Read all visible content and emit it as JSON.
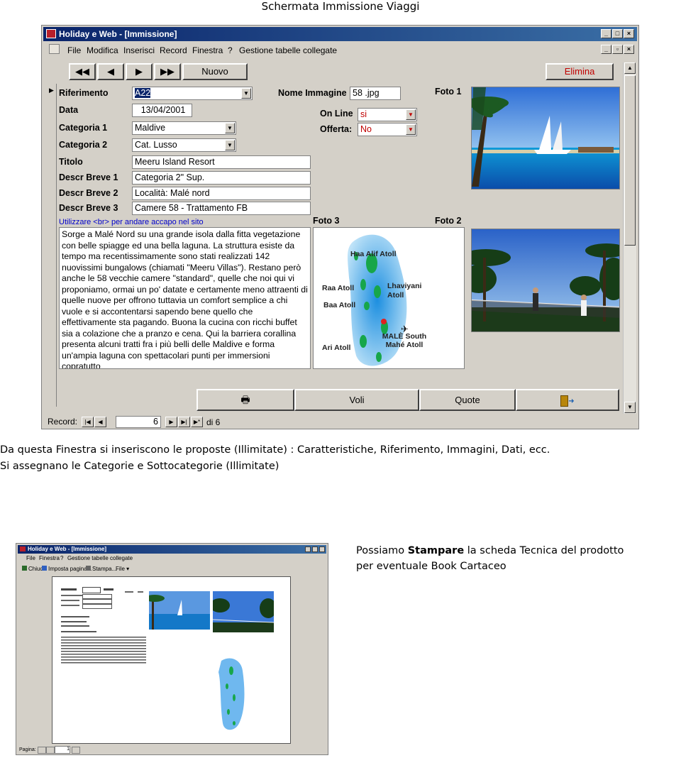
{
  "page_title": "Schermata Immissione Viaggi",
  "app": {
    "window_title": "Holiday e Web - [Immissione]",
    "menu": [
      "File",
      "Modifica",
      "Inserisci",
      "Record",
      "Finestra",
      "?",
      "Gestione tabelle collegate"
    ],
    "nav_buttons": {
      "first": "◀◀",
      "prev": "◀",
      "next": "▶",
      "last": "▶▶"
    },
    "nuovo": "Nuovo",
    "elimina": "Elimina",
    "labels": {
      "riferimento": "Riferimento",
      "data": "Data",
      "categoria1": "Categoria 1",
      "categoria2": "Categoria 2",
      "titolo": "Titolo",
      "descr1": "Descr Breve 1",
      "descr2": "Descr Breve 2",
      "descr3": "Descr Breve 3",
      "nome_immagine": "Nome Immagine",
      "on_line": "On Line",
      "offerta": "Offerta:",
      "foto1": "Foto 1",
      "foto2": "Foto 2",
      "foto3": "Foto 3"
    },
    "values": {
      "riferimento": "A22",
      "data": "13/04/2001",
      "categoria1": "Maldive",
      "categoria2": "Cat. Lusso",
      "titolo": "Meeru Island Resort",
      "descr1": "Categoria 2\" Sup.",
      "descr2": "Località: Malé nord",
      "descr3": "Camere 58 - Trattamento FB",
      "nome_immagine": "58 .jpg",
      "on_line": "si",
      "offerta": "No"
    },
    "hint": "Utilizzare <br> per andare accapo nel sito",
    "description": "Sorge a Malé Nord su una grande isola dalla fitta vegetazione con belle spiagge ed una bella laguna. La struttura esiste da tempo ma recentissimamente sono stati realizzati 142 nuovissimi bungalows (chiamati \"Meeru Villas\"). Restano però anche le 58 vecchie camere \"standard\", quelle che noi qui vi proponiamo, ormai un po' datate e certamente meno attraenti di quelle nuove per offrono tuttavia un comfort semplice a chi vuole e si accontentarsi sapendo bene quello che effettivamente sta pagando. Buona la cucina con ricchi buffet sia a colazione che a pranzo e cena. Qui la barriera corallina presenta alcuni tratti fra i più belli delle Maldive e forma un'ampia laguna con spettacolari punti per immersioni copratutto",
    "map_labels": [
      "Haa Alif Atoll",
      "Raa Atoll",
      "Lhaviyani Atoll",
      "Baa Atoll",
      "MALÈ South Mahé Atoll",
      "Ari Atoll"
    ],
    "bottom_buttons": {
      "voli": "Voli",
      "quote": "Quote"
    },
    "record_label": "Record:",
    "record_current": "6",
    "record_total": "di 6"
  },
  "captions": {
    "line1": "Da questa Finestra si inseriscono le proposte (Illimitate) : Caratteristiche, Riferimento, Immagini, Dati,  ecc.",
    "line2": "Si assegnano le Categorie e Sottocategorie (Illimitate)",
    "print_pre": "Possiamo ",
    "print_bold": "Stampare",
    "print_post": " la scheda Tecnica del prodotto",
    "print_line2": "per eventuale Book Cartaceo"
  },
  "preview_window": {
    "title": "Holiday e Web - [Immissione]",
    "menu": [
      "File",
      "Finestra",
      "?",
      "Gestione tabelle collegate"
    ],
    "toolbar": [
      "Chiudi",
      "Imposta pagina...",
      "Stampa...",
      "File"
    ],
    "page_label": "Pagina:",
    "page_value": "1"
  }
}
